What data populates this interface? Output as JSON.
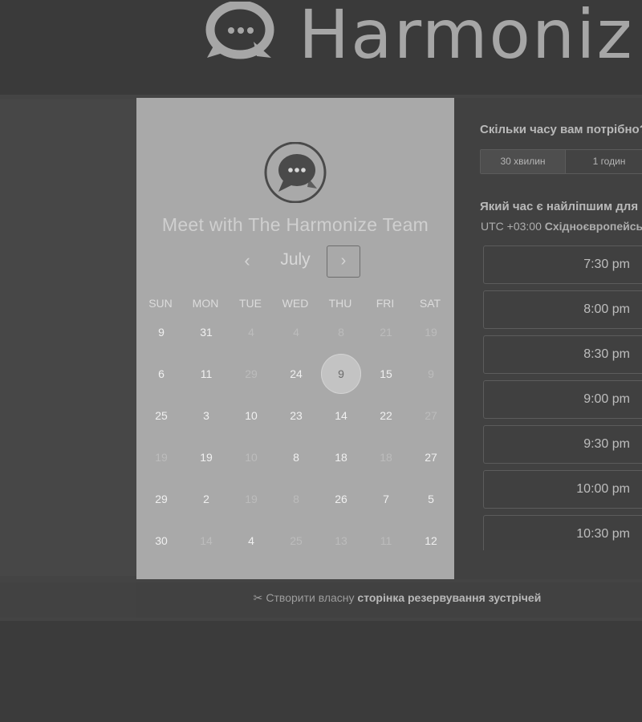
{
  "header": {
    "brand_name": "Harmoniz"
  },
  "calendar": {
    "title": "Meet with The Harmonize Team",
    "month": "July",
    "prev_icon": "‹",
    "next_icon": "›",
    "weekdays": [
      "SUN",
      "MON",
      "TUE",
      "WED",
      "THU",
      "FRI",
      "SAT"
    ],
    "weeks": [
      [
        {
          "d": "9",
          "s": "on"
        },
        {
          "d": "31",
          "s": "on"
        },
        {
          "d": "4",
          "s": "off"
        },
        {
          "d": "4",
          "s": "off"
        },
        {
          "d": "8",
          "s": "off"
        },
        {
          "d": "21",
          "s": "off"
        },
        {
          "d": "19",
          "s": "off"
        }
      ],
      [
        {
          "d": "6",
          "s": "on"
        },
        {
          "d": "11",
          "s": "on"
        },
        {
          "d": "29",
          "s": "off"
        },
        {
          "d": "24",
          "s": "on"
        },
        {
          "d": "9",
          "s": "sel"
        },
        {
          "d": "15",
          "s": "on"
        },
        {
          "d": "9",
          "s": "off"
        }
      ],
      [
        {
          "d": "25",
          "s": "on"
        },
        {
          "d": "3",
          "s": "on"
        },
        {
          "d": "10",
          "s": "on"
        },
        {
          "d": "23",
          "s": "on"
        },
        {
          "d": "14",
          "s": "on"
        },
        {
          "d": "22",
          "s": "on"
        },
        {
          "d": "27",
          "s": "off"
        }
      ],
      [
        {
          "d": "19",
          "s": "off"
        },
        {
          "d": "19",
          "s": "on"
        },
        {
          "d": "10",
          "s": "off"
        },
        {
          "d": "8",
          "s": "on"
        },
        {
          "d": "18",
          "s": "on"
        },
        {
          "d": "18",
          "s": "off"
        },
        {
          "d": "27",
          "s": "on"
        }
      ],
      [
        {
          "d": "29",
          "s": "on"
        },
        {
          "d": "2",
          "s": "on"
        },
        {
          "d": "19",
          "s": "off"
        },
        {
          "d": "8",
          "s": "off"
        },
        {
          "d": "26",
          "s": "on"
        },
        {
          "d": "7",
          "s": "on"
        },
        {
          "d": "5",
          "s": "on"
        }
      ],
      [
        {
          "d": "30",
          "s": "on"
        },
        {
          "d": "14",
          "s": "off"
        },
        {
          "d": "4",
          "s": "on"
        },
        {
          "d": "25",
          "s": "off"
        },
        {
          "d": "13",
          "s": "off"
        },
        {
          "d": "11",
          "s": "off"
        },
        {
          "d": "12",
          "s": "on"
        }
      ]
    ]
  },
  "booking": {
    "duration_question": "Скільки часу вам потрібно?",
    "durations": [
      "30 хвилин",
      "1 годин"
    ],
    "time_question": "Який час є найліпшим для вас?",
    "timezone_prefix": "UTC +03:00",
    "timezone_name": "Східноєвропейський час",
    "slots": [
      "7:30 pm",
      "8:00 pm",
      "8:30 pm",
      "9:00 pm",
      "9:30 pm",
      "10:00 pm",
      "10:30 pm"
    ]
  },
  "footer": {
    "prefix": "Створити власну",
    "link": "сторінка резервування зустрічей",
    "icon": "scissors-icon"
  },
  "colors": {
    "calendar_bg": "#a9a9a9",
    "page_bg": "#3b3b3b"
  }
}
